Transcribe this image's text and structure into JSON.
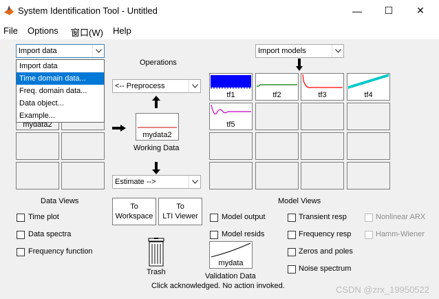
{
  "window": {
    "title": "System Identification Tool - Untitled",
    "minimize_glyph": "—",
    "maximize_glyph": "☐",
    "close_glyph": "✕"
  },
  "menu": [
    "File",
    "Options",
    "窗口(W)",
    "Help"
  ],
  "import_data": {
    "selected": "Import data",
    "options": [
      "Import data",
      "Time domain data...",
      "Freq. domain data...",
      "Data object...",
      "Example..."
    ],
    "highlighted": "Time domain data..."
  },
  "import_models": {
    "selected": "Import models"
  },
  "operations": {
    "title": "Operations",
    "preprocess": "<-- Preprocess",
    "estimate": "Estimate -->"
  },
  "data_board": {
    "slots": [
      {
        "label": "",
        "filled": false
      },
      {
        "label": "",
        "filled": false
      },
      {
        "label": "mydata2",
        "filled": true
      },
      {
        "label": "",
        "filled": false
      }
    ]
  },
  "working_data": {
    "name": "mydata2",
    "caption": "Working Data"
  },
  "model_board": {
    "models": [
      {
        "label": "tf1",
        "color": "#0000ff",
        "kind": "square"
      },
      {
        "label": "tf2",
        "color": "#007700",
        "kind": "step"
      },
      {
        "label": "tf3",
        "color": "#ff0000",
        "kind": "decay"
      },
      {
        "label": "tf4",
        "color": "#00c8c8",
        "kind": "ramp"
      },
      {
        "label": "tf5",
        "color": "#bf00bf",
        "kind": "osc"
      }
    ]
  },
  "to_workspace": {
    "line1": "To",
    "line2": "Workspace"
  },
  "to_lti": {
    "line1": "To",
    "line2": "LTI Viewer"
  },
  "data_views": {
    "title": "Data Views",
    "items": [
      "Time plot",
      "Data spectra",
      "Frequency function"
    ]
  },
  "trash": {
    "label": "Trash"
  },
  "validation": {
    "name": "mydata",
    "caption": "Validation Data"
  },
  "model_views": {
    "title": "Model Views",
    "col1": [
      "Model output",
      "Model resids"
    ],
    "col2": [
      "Transient resp",
      "Frequency resp",
      "Zeros and poles",
      "Noise spectrum"
    ],
    "col3": [
      "Nonlinear ARX",
      "Hamm-Wiener"
    ]
  },
  "status": "Click acknowledged. No action invoked.",
  "watermark": "CSDN @zrx_19950522"
}
